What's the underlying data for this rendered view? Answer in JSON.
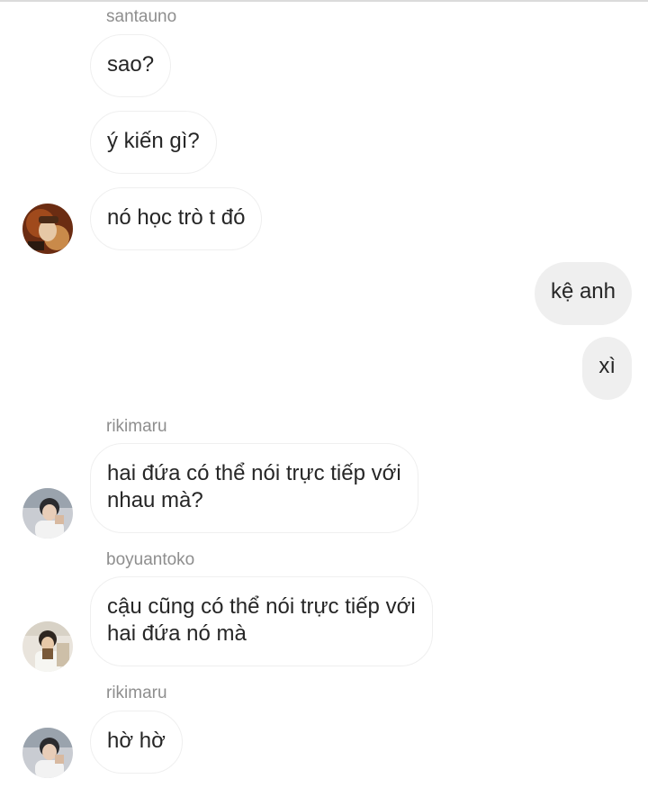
{
  "messages": {
    "sender_1": "santauno",
    "m1": "sao?",
    "m2": "ý kiến gì?",
    "m3": "nó học trò t đó",
    "me1": "kệ anh",
    "me2": "xì",
    "sender_2": "rikimaru",
    "m4_line1": "hai đứa có thể nói trực tiếp với",
    "m4_line2": "nhau mà?",
    "sender_3": "boyuantoko",
    "m5_line1": "cậu cũng có thể nói trực tiếp với",
    "m5_line2": "hai đứa nó mà",
    "sender_4": "rikimaru",
    "m6": "hờ hờ"
  },
  "colors": {
    "incoming_border": "#efefef",
    "outgoing_bg": "#efefef",
    "sender_text": "#8e8e8e",
    "message_text": "#262626"
  }
}
